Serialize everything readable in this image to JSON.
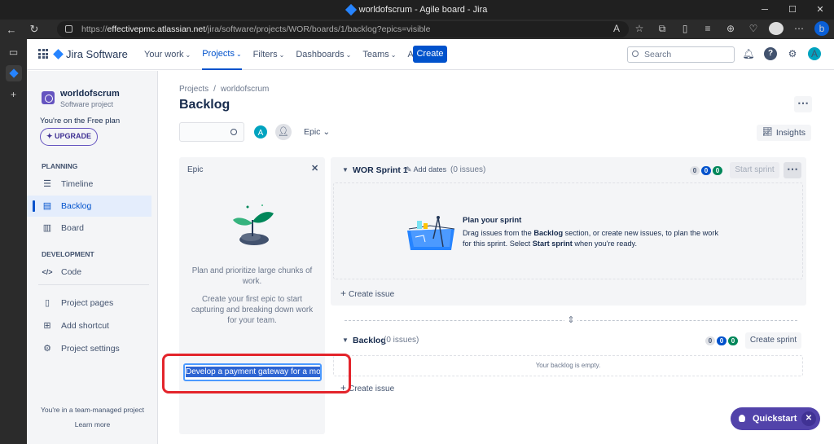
{
  "browser": {
    "tab_title": "worldofscrum - Agile board - Jira",
    "url_prefix": "https://",
    "url_host": "effectivepmc.atlassian.net",
    "url_path": "/jira/software/projects/WOR/boards/1/backlog?epics=visible",
    "copilot_label": "b"
  },
  "topnav": {
    "brand": "Jira Software",
    "items": [
      {
        "label": "Your work",
        "active": false
      },
      {
        "label": "Projects",
        "active": true
      },
      {
        "label": "Filters",
        "active": false
      },
      {
        "label": "Dashboards",
        "active": false
      },
      {
        "label": "Teams",
        "active": false
      },
      {
        "label": "Apps",
        "active": false
      }
    ],
    "create_label": "Create",
    "search_placeholder": "Search",
    "user_initial": "A"
  },
  "sidebar": {
    "project_name": "worldofscrum",
    "project_type": "Software project",
    "plan_text": "You're on the Free plan",
    "upgrade_label": "UPGRADE",
    "planning_header": "PLANNING",
    "development_header": "DEVELOPMENT",
    "items": [
      {
        "label": "Timeline",
        "icon": "timeline-icon",
        "glyph": "☰"
      },
      {
        "label": "Backlog",
        "icon": "backlog-icon",
        "glyph": "▤"
      },
      {
        "label": "Board",
        "icon": "board-icon",
        "glyph": "▥"
      },
      {
        "label": "Code",
        "icon": "code-icon",
        "glyph": "</>"
      },
      {
        "label": "Project pages",
        "icon": "pages-icon",
        "glyph": "▯"
      },
      {
        "label": "Add shortcut",
        "icon": "add-shortcut-icon",
        "glyph": "⊞"
      },
      {
        "label": "Project settings",
        "icon": "settings-icon",
        "glyph": "⚙"
      }
    ],
    "footer_text": "You're in a team-managed project",
    "learn_more": "Learn more"
  },
  "main": {
    "breadcrumb": [
      "Projects",
      "worldofscrum"
    ],
    "title": "Backlog",
    "user_initial": "A",
    "epic_filter": "Epic",
    "insights_label": "Insights"
  },
  "epic_panel": {
    "title": "Epic",
    "desc1": "Plan and prioritize large chunks of work.",
    "desc2": "Create your first epic to start capturing and breaking down work for your team.",
    "input_value": "Develop a payment gateway for a mobil"
  },
  "sprint": {
    "name": "WOR Sprint 1",
    "add_dates": "Add dates",
    "issue_count": "(0 issues)",
    "counts": [
      "0",
      "0",
      "0"
    ],
    "start_label": "Start sprint",
    "plan_title": "Plan your sprint",
    "plan_text_1": "Drag issues from the ",
    "plan_text_bold1": "Backlog",
    "plan_text_2": " section, or create new issues, to plan the work for this sprint. Select ",
    "plan_text_bold2": "Start sprint",
    "plan_text_3": " when you're ready.",
    "create_issue": "Create issue"
  },
  "backlog": {
    "name": "Backlog",
    "issue_count": "(0 issues)",
    "counts": [
      "0",
      "0",
      "0"
    ],
    "create_sprint": "Create sprint",
    "empty_text": "Your backlog is empty.",
    "create_issue": "Create issue"
  },
  "quickstart": {
    "label": "Quickstart"
  },
  "colors": {
    "accent": "#0052cc",
    "highlight": "#e3242b",
    "quickstart": "#5243aa"
  }
}
